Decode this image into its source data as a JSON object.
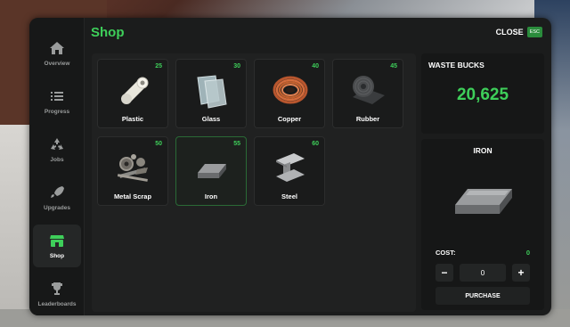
{
  "header": {
    "title": "Shop",
    "close_label": "CLOSE",
    "close_key": "ESC"
  },
  "sidebar": {
    "items": [
      {
        "label": "Overview",
        "icon": "home-icon",
        "active": false
      },
      {
        "label": "Progress",
        "icon": "list-icon",
        "active": false
      },
      {
        "label": "Jobs",
        "icon": "recycle-icon",
        "active": false
      },
      {
        "label": "Upgrades",
        "icon": "rocket-icon",
        "active": false
      },
      {
        "label": "Shop",
        "icon": "store-icon",
        "active": true
      },
      {
        "label": "Leaderboards",
        "icon": "trophy-icon",
        "active": false
      }
    ]
  },
  "shop": {
    "items": [
      {
        "name": "Plastic",
        "cost": "25",
        "icon": "plastic-roll-icon"
      },
      {
        "name": "Glass",
        "cost": "30",
        "icon": "glass-panes-icon"
      },
      {
        "name": "Copper",
        "cost": "40",
        "icon": "copper-coil-icon"
      },
      {
        "name": "Rubber",
        "cost": "45",
        "icon": "rubber-roll-icon"
      },
      {
        "name": "Metal Scrap",
        "cost": "50",
        "icon": "metal-scrap-icon"
      },
      {
        "name": "Iron",
        "cost": "55",
        "icon": "iron-ingot-icon",
        "selected": true
      },
      {
        "name": "Steel",
        "cost": "60",
        "icon": "steel-beam-icon"
      }
    ]
  },
  "wallet": {
    "title": "WASTE BUCKS",
    "amount": "20,625"
  },
  "detail": {
    "title": "IRON",
    "icon": "iron-ingot-icon",
    "cost_label": "COST:",
    "cost_value": "0",
    "quantity": "0",
    "minus_label": "−",
    "plus_label": "+",
    "purchase_label": "PURCHASE"
  },
  "colors": {
    "accent": "#3ecf5a",
    "panel": "#1b1c1c",
    "esc_badge": "#2a8c3c"
  }
}
